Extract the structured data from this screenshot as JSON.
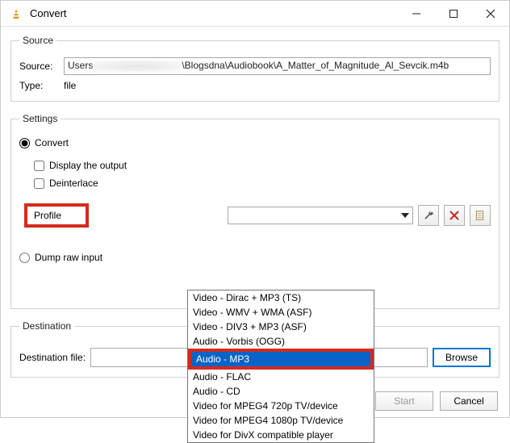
{
  "window": {
    "title": "Convert"
  },
  "source": {
    "legend": "Source",
    "source_label": "Source:",
    "source_value_prefix": "Users",
    "source_value_suffix": "\\Blogsdna\\Audiobook\\A_Matter_of_Magnitude_Al_Sevcik.m4b",
    "type_label": "Type:",
    "type_value": "file"
  },
  "settings": {
    "legend": "Settings",
    "convert_label": "Convert",
    "display_output_label": "Display the output",
    "deinterlace_label": "Deinterlace",
    "profile_label": "Profile",
    "dump_raw_label": "Dump raw input",
    "dropdown_options": [
      "Video - Dirac + MP3 (TS)",
      "Video - WMV + WMA (ASF)",
      "Video - DIV3 + MP3 (ASF)",
      "Audio - Vorbis (OGG)",
      "Audio - MP3",
      "Audio - FLAC",
      "Audio - CD",
      "Video for MPEG4 720p TV/device",
      "Video for MPEG4 1080p TV/device",
      "Video for DivX compatible player"
    ],
    "dropdown_selected_index": 4
  },
  "destination": {
    "legend": "Destination",
    "file_label": "Destination file:",
    "browse_label": "Browse"
  },
  "footer": {
    "start_label": "Start",
    "cancel_label": "Cancel"
  }
}
